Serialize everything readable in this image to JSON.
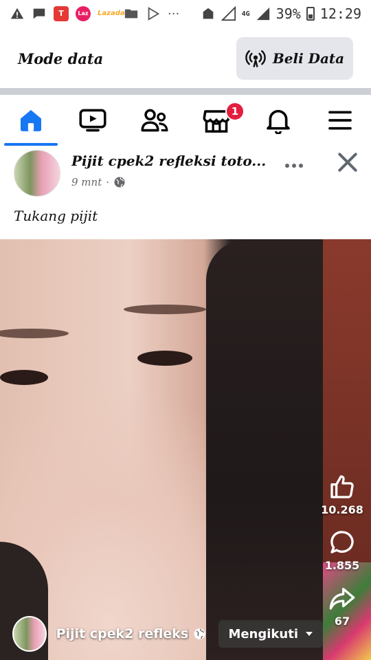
{
  "status_bar": {
    "network": "4G",
    "battery": "39%",
    "time": "12:29",
    "app_icons": [
      "T",
      "Laz",
      "Lazada"
    ]
  },
  "mode_bar": {
    "title": "Mode data",
    "buy_label": "Beli Data"
  },
  "nav": {
    "items": [
      "home",
      "watch",
      "friends",
      "marketplace",
      "notifications",
      "menu"
    ],
    "marketplace_badge": "1"
  },
  "post": {
    "author": "Pijit cpek2 refleksi toto...",
    "time": "9 mnt",
    "audience_icon": "globe-icon",
    "text": "Tukang pijit"
  },
  "video": {
    "likes": "10.268",
    "comments": "1.855",
    "shares": "67",
    "footer_name": "Pijit cpek2 refleksi...",
    "follow_label": "Mengikuti"
  },
  "colors": {
    "accent": "#1877f2",
    "badge": "#e41e3f",
    "divider": "#ccd0d5"
  }
}
